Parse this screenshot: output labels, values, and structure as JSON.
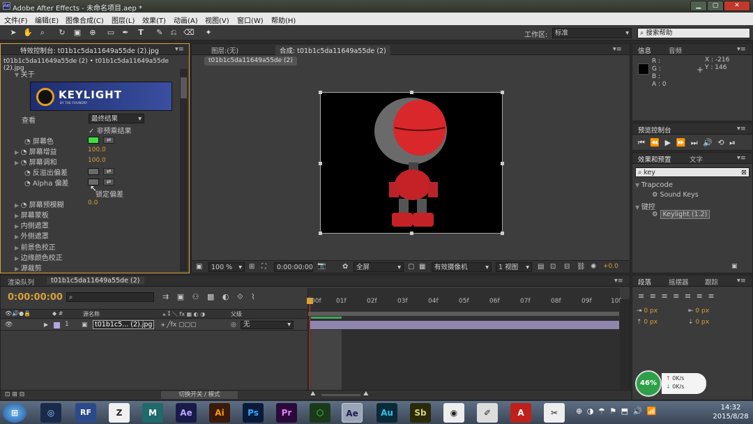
{
  "window": {
    "title": "Adobe After Effects - 未命名项目.aep *",
    "min": "▁",
    "max": "▢",
    "close": "✕"
  },
  "menu": [
    "文件(F)",
    "编辑(E)",
    "图像合成(C)",
    "图层(L)",
    "效果(T)",
    "动画(A)",
    "视图(V)",
    "窗口(W)",
    "帮助(H)"
  ],
  "toolbar": {
    "workspace_label": "工作区:",
    "workspace_value": "标准",
    "search_help": "搜索帮助"
  },
  "effect_panel": {
    "tab": "特效控制台: t01b1c5da11649a55de (2).jpg",
    "breadcrumb": "t01b1c5da11649a55de (2) • t01b1c5da11649a55de (2).jpg",
    "about": "关于",
    "logo_text": "KEYLIGHT",
    "logo_sub": "BY THE FOUNDRY",
    "view_label": "查看",
    "view_value": "最终结果",
    "unpremult": "非预乘结果",
    "screen_color": "屏幕色",
    "screen_gain": "屏幕增益",
    "screen_gain_val": "100.0",
    "screen_balance": "屏幕调和",
    "screen_balance_val": "100.0",
    "despill_bias": "反溢出偏差",
    "alpha_bias": "Alpha 偏差",
    "lock_bias": "锁定偏差",
    "screen_preblur": "屏幕预模糊",
    "screen_preblur_val": "0.0",
    "screen_matte": "屏幕蒙板",
    "inside_mask": "内侧遮罩",
    "outside_mask": "外侧遮罩",
    "fg_color_correction": "前景色校正",
    "edge_color_correction": "边缘颜色校正",
    "source_crops": "源裁剪",
    "eyedropper": "⇌"
  },
  "comp_panel": {
    "tab_layer": "图层:(无)",
    "tab_comp": "合成: t01b1c5da11649a55de (2)",
    "comp_chip": "t01b1c5da11649a55de (2)",
    "zoom": "100 %",
    "timecode": "0:00:00:00",
    "resolution": "全屏",
    "camera": "有效摄像机",
    "views": "1 视图",
    "exposure": "+0.0"
  },
  "info_panel": {
    "tab_info": "信息",
    "tab_audio": "音频",
    "r": "R :",
    "g": "G :",
    "b": "B :",
    "a": "A : 0",
    "x": "X : -216",
    "y": "Y : 146"
  },
  "preview_panel": {
    "tab": "预览控制台"
  },
  "effects_panel": {
    "tab": "效果和预置",
    "tab2": "文字",
    "search": "key",
    "cat1": "Trapcode",
    "item1": "Sound Keys",
    "cat2": "键控",
    "item2": "Keylight (1.2)"
  },
  "paragraph_panel": {
    "tab1": "段落",
    "tab2": "摇摆器",
    "tab3": "跟踪",
    "px": "0 px"
  },
  "timeline": {
    "tab1": "渲染队列",
    "tab2": "t01b1c5da11649a55de (2)",
    "timecode": "0:00:00:00",
    "col_source": "源名称",
    "col_parent": "父级",
    "layer_index": "1",
    "layer_name": "t01b1c5... (2).jpg",
    "parent_value": "无",
    "ruler": [
      "00f",
      "01f",
      "02f",
      "03f",
      "04f",
      "05f",
      "06f",
      "07f",
      "08f",
      "09f",
      "10f"
    ],
    "toggle_modes": "切换开关 / 模式"
  },
  "speed_widget": {
    "percent": "46%",
    "up": "0K/s",
    "down": "0K/s"
  },
  "taskbar": {
    "apps": [
      "RF",
      "Ae",
      "Ai",
      "Ps",
      "Pr",
      "Ae",
      "Au",
      "Sb"
    ],
    "time": "14:32",
    "date": "2015/8/28"
  }
}
